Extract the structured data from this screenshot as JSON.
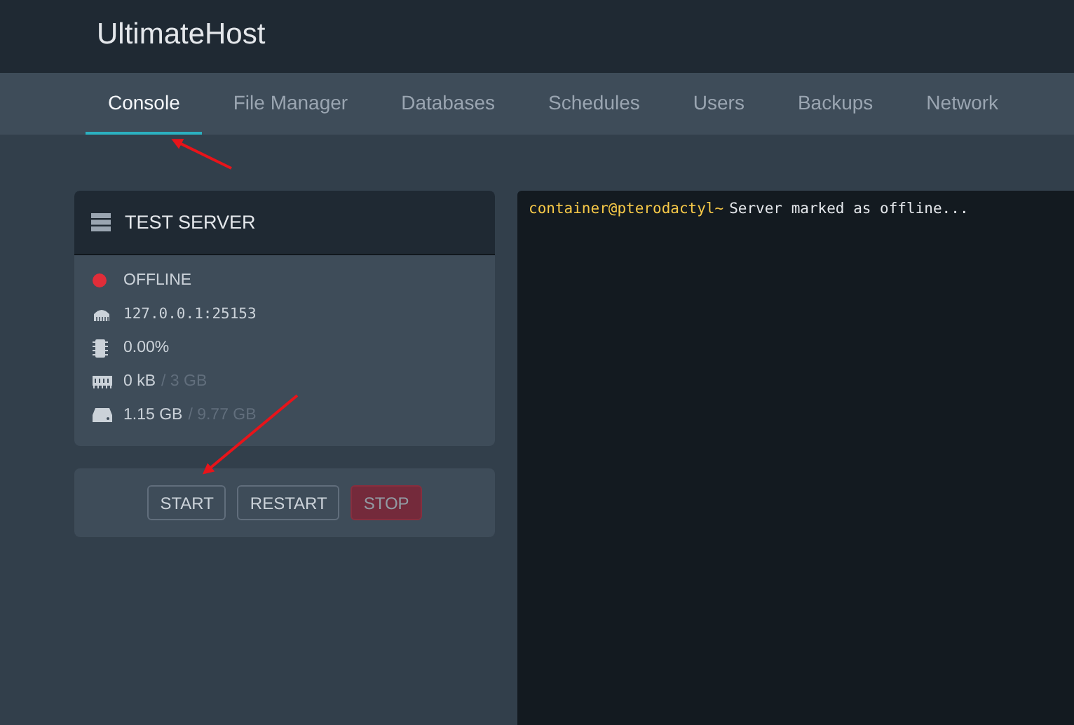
{
  "brand": "UltimateHost",
  "tabs": [
    {
      "label": "Console",
      "selected": true
    },
    {
      "label": "File Manager",
      "selected": false
    },
    {
      "label": "Databases",
      "selected": false
    },
    {
      "label": "Schedules",
      "selected": false
    },
    {
      "label": "Users",
      "selected": false
    },
    {
      "label": "Backups",
      "selected": false
    },
    {
      "label": "Network",
      "selected": false
    }
  ],
  "server": {
    "name": "TEST SERVER",
    "stats": [
      {
        "kind": "status",
        "value": "OFFLINE",
        "color": "#e12d39"
      },
      {
        "kind": "address",
        "value": "127.0.0.1:25153"
      },
      {
        "kind": "cpu",
        "value": "0.00%"
      },
      {
        "kind": "memory",
        "value": "0 kB",
        "limit": "/ 3 GB"
      },
      {
        "kind": "disk",
        "value": "1.15 GB",
        "limit": "/ 9.77 GB"
      }
    ]
  },
  "buttons": [
    {
      "label": "START",
      "kind": "neutral",
      "disabled": false
    },
    {
      "label": "RESTART",
      "kind": "neutral",
      "disabled": false
    },
    {
      "label": "STOP",
      "kind": "danger",
      "disabled": true
    }
  ],
  "console": {
    "lines": [
      {
        "prompt": "container@pterodactyl~",
        "text": "Server marked as offline..."
      }
    ]
  }
}
